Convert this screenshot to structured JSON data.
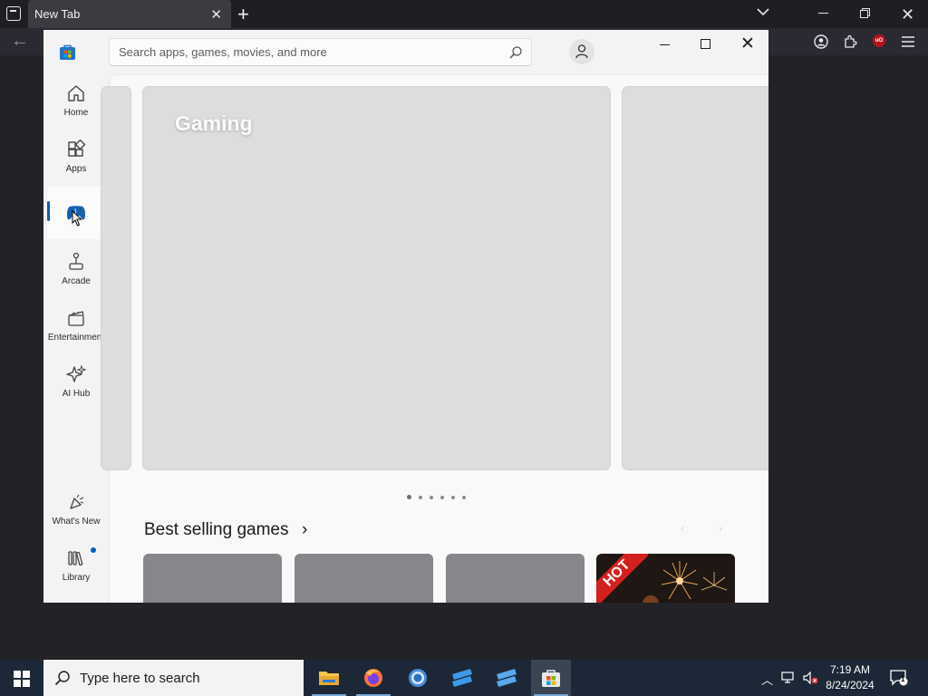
{
  "browser": {
    "tab_title": "New Tab",
    "tab_close_label": "✕",
    "new_tab_label": "+"
  },
  "store": {
    "search_placeholder": "Search apps, games, movies, and more",
    "sidebar": {
      "items": [
        {
          "label": "Home",
          "icon": "home-icon"
        },
        {
          "label": "Apps",
          "icon": "apps-icon"
        },
        {
          "label": "",
          "icon": "gaming-controller-icon",
          "active": true
        },
        {
          "label": "Arcade",
          "icon": "joystick-icon"
        },
        {
          "label": "Entertainment",
          "icon": "clapperboard-icon"
        },
        {
          "label": "AI Hub",
          "icon": "sparkle-icon"
        }
      ],
      "bottom_items": [
        {
          "label": "What's New",
          "icon": "party-popper-icon"
        },
        {
          "label": "Library",
          "icon": "library-books-icon",
          "badge": true
        }
      ]
    },
    "hero": {
      "title": "Gaming",
      "page_count": 6,
      "active_page": 1
    },
    "best_selling": {
      "title": "Best selling games",
      "chevron": "›",
      "cards": [
        {
          "badge": ""
        },
        {
          "badge": ""
        },
        {
          "badge": ""
        },
        {
          "badge": "HOT"
        }
      ]
    }
  },
  "taskbar": {
    "search_text": "Type here to search",
    "time": "7:19 AM",
    "date": "8/24/2024",
    "notification_count": "1",
    "apps": [
      "file-explorer-icon",
      "firefox-icon",
      "chrome-icon",
      "roblox-icon",
      "roblox-studio-icon",
      "microsoft-store-icon"
    ]
  },
  "colors": {
    "accent": "#005fb8",
    "taskbar": "#1c2837",
    "browser_chrome": "#1f1e23"
  }
}
